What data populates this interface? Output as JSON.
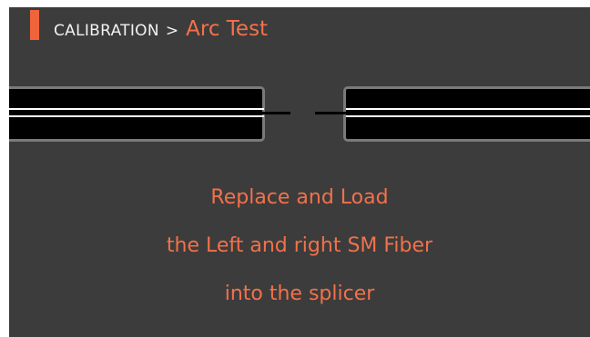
{
  "header": {
    "parent": "CALIBRATION",
    "separator": ">",
    "current": "Arc Test"
  },
  "message": {
    "lines": [
      "Replace and Load",
      "the Left and right SM Fiber",
      "into the splicer"
    ]
  },
  "colors": {
    "accent": "#f0643c",
    "text_highlight": "#f3714a",
    "screen_background": "#3c3c3c",
    "holder_border": "#7a7a7a"
  }
}
